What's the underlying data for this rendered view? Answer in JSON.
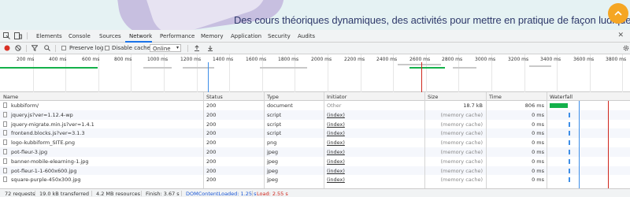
{
  "banner": {
    "headline": "Des cours théoriques dynamiques, des activités pour mettre en pratique de façon ludique tous"
  },
  "tabs": [
    {
      "label": "Elements"
    },
    {
      "label": "Console"
    },
    {
      "label": "Sources"
    },
    {
      "label": "Network"
    },
    {
      "label": "Performance"
    },
    {
      "label": "Memory"
    },
    {
      "label": "Application"
    },
    {
      "label": "Security"
    },
    {
      "label": "Audits"
    }
  ],
  "toolbar": {
    "preserve_log": "Preserve log",
    "disable_cache": "Disable cache",
    "throttling": "Online"
  },
  "timeline": {
    "ticks": [
      "200 ms",
      "400 ms",
      "600 ms",
      "800 ms",
      "1000 ms",
      "1200 ms",
      "1400 ms",
      "1600 ms",
      "1800 ms",
      "2000 ms",
      "2200 ms",
      "2400 ms",
      "2600 ms",
      "2800 ms",
      "3000 ms",
      "3200 ms",
      "3400 ms",
      "3600 ms",
      "3800 ms"
    ]
  },
  "table": {
    "headers": [
      "Name",
      "Status",
      "Type",
      "Initiator",
      "Size",
      "Time",
      "Waterfall"
    ],
    "rows": [
      {
        "name": "kubbiform/",
        "status": "200",
        "type": "document",
        "initiator": "Other",
        "size": "18.7 kB",
        "time": "806 ms"
      },
      {
        "name": "jquery.js?ver=1.12.4-wp",
        "status": "200",
        "type": "script",
        "initiator": "(index)",
        "size": "(memory cache)",
        "time": "0 ms"
      },
      {
        "name": "jquery-migrate.min.js?ver=1.4.1",
        "status": "200",
        "type": "script",
        "initiator": "(index)",
        "size": "(memory cache)",
        "time": "0 ms"
      },
      {
        "name": "frontend.blocks.js?ver=3.1.3",
        "status": "200",
        "type": "script",
        "initiator": "(index)",
        "size": "(memory cache)",
        "time": "0 ms"
      },
      {
        "name": "logo-kubbiform_SITE.png",
        "status": "200",
        "type": "png",
        "initiator": "(index)",
        "size": "(memory cache)",
        "time": "0 ms"
      },
      {
        "name": "pot-fleur-3.jpg",
        "status": "200",
        "type": "jpeg",
        "initiator": "(index)",
        "size": "(memory cache)",
        "time": "0 ms"
      },
      {
        "name": "banner-mobile-elearning-1.jpg",
        "status": "200",
        "type": "jpeg",
        "initiator": "(index)",
        "size": "(memory cache)",
        "time": "0 ms"
      },
      {
        "name": "pot-fleur-1-1-600x600.jpg",
        "status": "200",
        "type": "jpeg",
        "initiator": "(index)",
        "size": "(memory cache)",
        "time": "0 ms"
      },
      {
        "name": "square-purple-450x300.jpg",
        "status": "200",
        "type": "jpeg",
        "initiator": "(index)",
        "size": "(memory cache)",
        "time": "0 ms"
      }
    ]
  },
  "status": {
    "requests": "72 requests",
    "transferred": "19.0 kB transferred",
    "resources": "4.2 MB resources",
    "finish": "Finish: 3.67 s",
    "dcl": "DOMContentLoaded: 1.25 s",
    "load": "Load: 2.55 s"
  },
  "colors": {
    "accent": "#1a73e8",
    "record": "#d93025",
    "waterfall_green": "#14b14a",
    "waterfall_blue": "#3d8ee8",
    "dcl_blue": "#1a57d6",
    "load_red": "#d0271d"
  },
  "icons": [
    "chevron-up-icon",
    "cursor-select-icon",
    "device-toggle-icon",
    "record-icon",
    "clear-icon",
    "filter-icon",
    "search-icon",
    "upload-icon",
    "download-icon",
    "settings-gear-icon",
    "close-icon"
  ]
}
